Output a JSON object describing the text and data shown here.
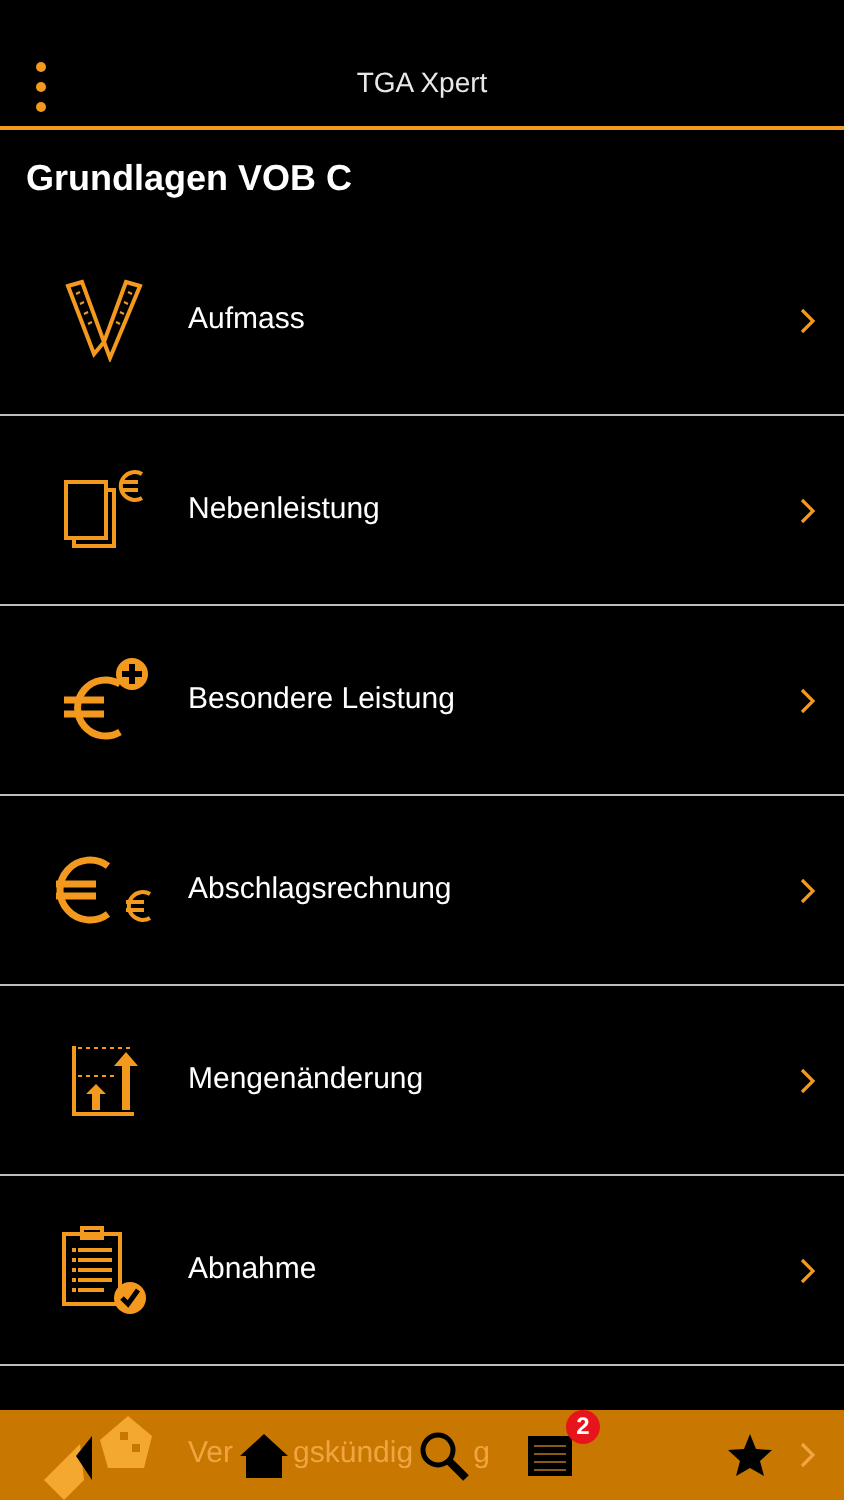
{
  "header": {
    "title": "TGA Xpert"
  },
  "section_title": "Grundlagen VOB C",
  "items": [
    {
      "label": "Aufmass",
      "kind": "ruler"
    },
    {
      "label": "Nebenleistung",
      "kind": "pages"
    },
    {
      "label": "Besondere Leistung",
      "kind": "europlus"
    },
    {
      "label": "Abschlagsrechnung",
      "kind": "euros"
    },
    {
      "label": "Mengenänderung",
      "kind": "chart"
    },
    {
      "label": "Abnahme",
      "kind": "clipboard"
    }
  ],
  "covered_item": {
    "label_parts": [
      "Ver",
      "gskündig",
      "g"
    ]
  },
  "tab_bar": {
    "tabs": [
      {
        "kind": "logo"
      },
      {
        "kind": "home"
      },
      {
        "kind": "search"
      },
      {
        "kind": "list",
        "badge": "2"
      },
      {
        "kind": "star"
      }
    ]
  }
}
